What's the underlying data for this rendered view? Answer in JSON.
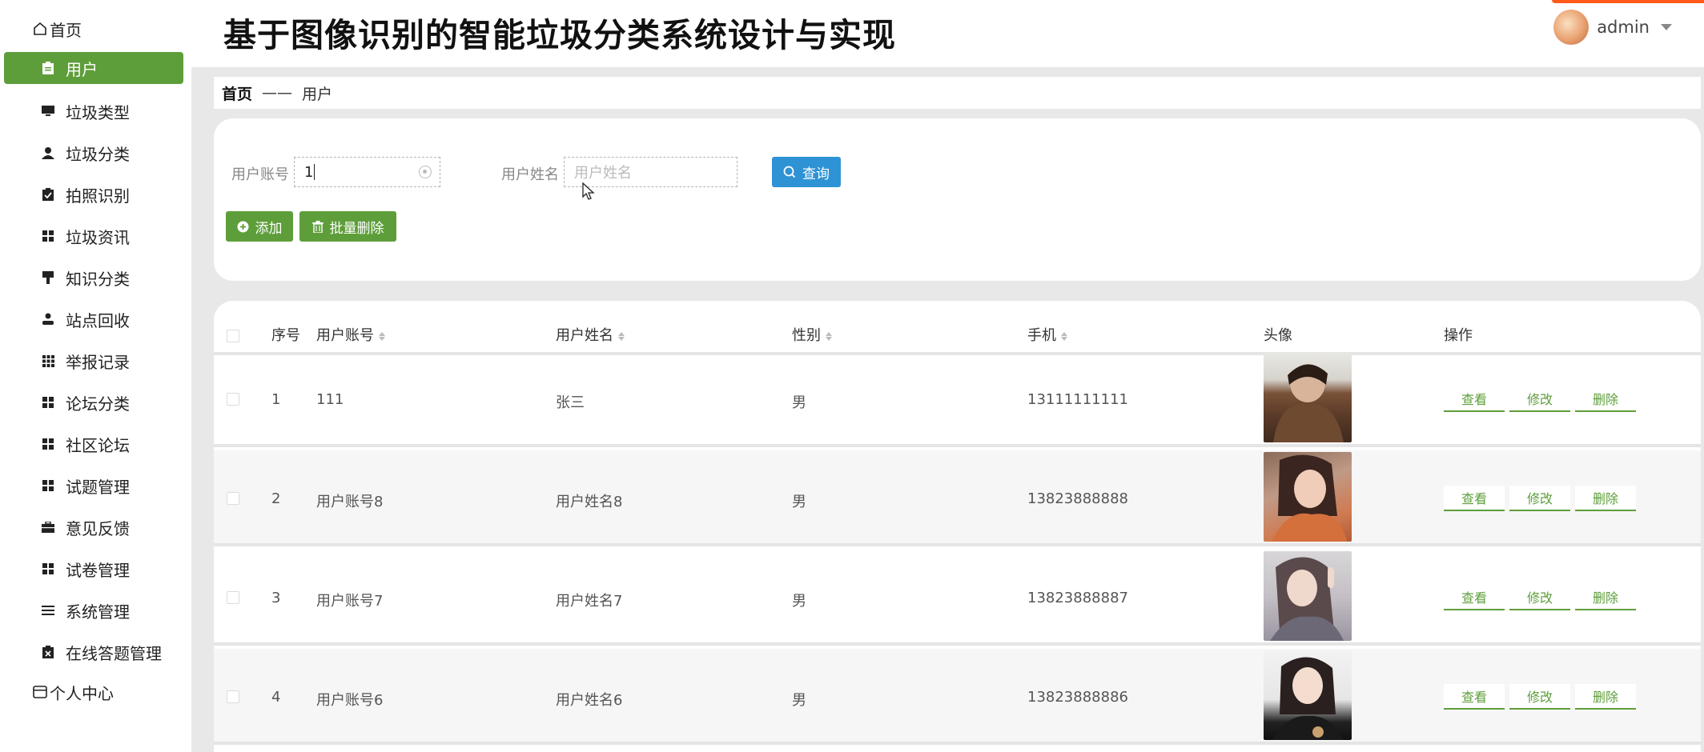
{
  "sidebar": {
    "home_label": "首页",
    "items": [
      {
        "label": "用户",
        "icon": "clipboard-icon",
        "active": true
      },
      {
        "label": "垃圾类型",
        "icon": "monitor-icon"
      },
      {
        "label": "垃圾分类",
        "icon": "user-icon"
      },
      {
        "label": "拍照识别",
        "icon": "clipboard-check-icon"
      },
      {
        "label": "垃圾资讯",
        "icon": "grid-icon"
      },
      {
        "label": "知识分类",
        "icon": "flag-icon"
      },
      {
        "label": "站点回收",
        "icon": "person-icon"
      },
      {
        "label": "举报记录",
        "icon": "apps-icon"
      },
      {
        "label": "论坛分类",
        "icon": "grid-icon"
      },
      {
        "label": "社区论坛",
        "icon": "grid-icon"
      },
      {
        "label": "试题管理",
        "icon": "grid-icon"
      },
      {
        "label": "意见反馈",
        "icon": "briefcase-icon"
      },
      {
        "label": "试卷管理",
        "icon": "grid-icon"
      },
      {
        "label": "系统管理",
        "icon": "list-icon"
      },
      {
        "label": "在线答题管理",
        "icon": "clipboard-x-icon"
      }
    ],
    "personal_label": "个人中心"
  },
  "header": {
    "title": "基于图像识别的智能垃圾分类系统设计与实现",
    "username": "admin"
  },
  "breadcrumb": {
    "home": "首页",
    "separator": "——",
    "current": "用户"
  },
  "search": {
    "account_label": "用户账号",
    "account_value": "1",
    "name_label": "用户姓名",
    "name_placeholder": "用户姓名",
    "search_button": "查询",
    "add_button": "添加",
    "batch_delete_button": "批量删除"
  },
  "table": {
    "headers": {
      "index": "序号",
      "account": "用户账号",
      "name": "用户姓名",
      "gender": "性别",
      "phone": "手机",
      "avatar": "头像",
      "actions": "操作"
    },
    "rows": [
      {
        "index": "1",
        "account": "111",
        "name": "张三",
        "gender": "男",
        "phone": "13111111111"
      },
      {
        "index": "2",
        "account": "用户账号8",
        "name": "用户姓名8",
        "gender": "男",
        "phone": "13823888888"
      },
      {
        "index": "3",
        "account": "用户账号7",
        "name": "用户姓名7",
        "gender": "男",
        "phone": "13823888887"
      },
      {
        "index": "4",
        "account": "用户账号6",
        "name": "用户姓名6",
        "gender": "男",
        "phone": "13823888886"
      }
    ],
    "action_labels": {
      "view": "查看",
      "edit": "修改",
      "delete": "删除"
    }
  },
  "colors": {
    "accent_green": "#5e9e3a",
    "button_blue": "#2e93d5"
  }
}
